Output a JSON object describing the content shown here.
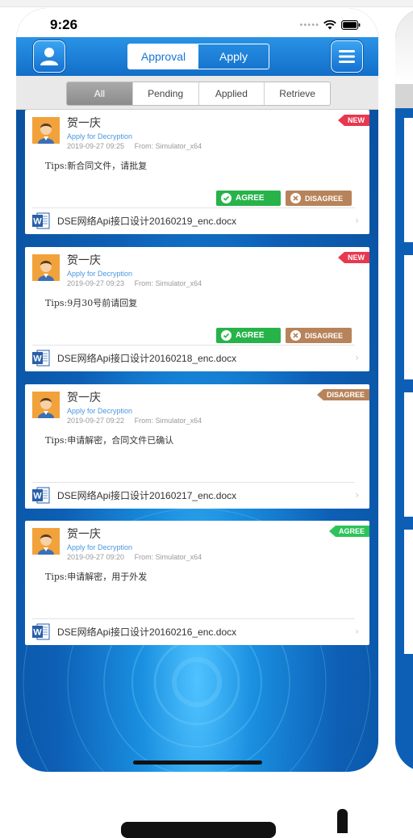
{
  "status_bar": {
    "time": "9:26"
  },
  "nav": {
    "tabs": [
      {
        "label": "Approval",
        "active": true
      },
      {
        "label": "Apply",
        "active": false
      }
    ]
  },
  "filters": [
    {
      "label": "All",
      "active": true
    },
    {
      "label": "Pending",
      "active": false
    },
    {
      "label": "Applied",
      "active": false
    },
    {
      "label": "Retrieve",
      "active": false
    }
  ],
  "buttons": {
    "agree": "AGREE",
    "disagree": "DISAGREE"
  },
  "colors": {
    "primary": "#1677d2",
    "new_badge": "#e8384f",
    "agree": "#27b34a",
    "disagree": "#b7835a",
    "subtitle": "#4a96e0"
  },
  "cards": [
    {
      "name": "贺一庆",
      "subtitle": "Apply for Decryption",
      "date": "2019-09-27 09:25",
      "from": "From: Simulator_x64",
      "tips": "Tips:新合同文件，请批复",
      "badge": "NEW",
      "show_actions": true,
      "file": "DSE网络Api接口设计20160219_enc.docx"
    },
    {
      "name": "贺一庆",
      "subtitle": "Apply for Decryption",
      "date": "2019-09-27 09:23",
      "from": "From: Simulator_x64",
      "tips": "Tips:9月30号前请回复",
      "badge": "NEW",
      "show_actions": true,
      "file": "DSE网络Api接口设计20160218_enc.docx"
    },
    {
      "name": "贺一庆",
      "subtitle": "Apply for Decryption",
      "date": "2019-09-27 09:22",
      "from": "From: Simulator_x64",
      "tips": "Tips:申请解密，合同文件已确认",
      "badge": "DISAGREE",
      "show_actions": false,
      "file": "DSE网络Api接口设计20160217_enc.docx"
    },
    {
      "name": "贺一庆",
      "subtitle": "Apply for Decryption",
      "date": "2019-09-27 09:20",
      "from": "From: Simulator_x64",
      "tips": "Tips:申请解密，用于外发",
      "badge": "AGREE",
      "show_actions": false,
      "file": "DSE网络Api接口设计20160216_enc.docx"
    }
  ]
}
